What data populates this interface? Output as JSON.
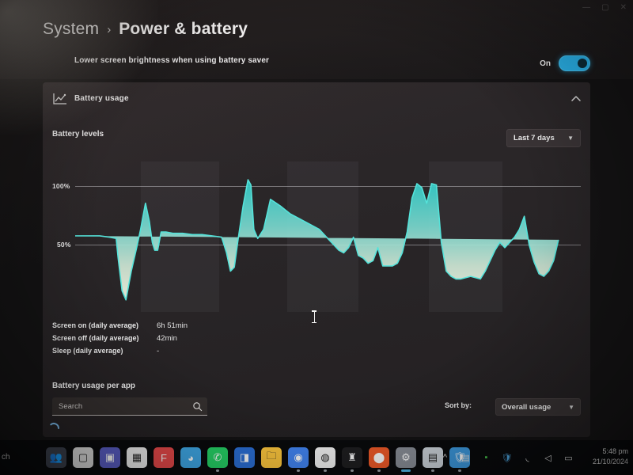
{
  "window": {
    "breadcrumb_root": "System",
    "breadcrumb_separator": "›",
    "page_title": "Power & battery",
    "controls": [
      "minimize-icon",
      "maximize-icon",
      "close-icon"
    ]
  },
  "brightness_setting": {
    "label": "Lower screen brightness when using battery saver",
    "toggle_state_label": "On",
    "toggle_on": true,
    "accent_color": "#2ab6ef"
  },
  "battery_usage_card": {
    "icon": "line-chart-icon",
    "title": "Battery usage",
    "collapse_icon": "chevron-up-icon",
    "section_title": "Battery levels",
    "range_dropdown": {
      "value": "Last 7 days",
      "chevron": "chevron-down-icon"
    },
    "stats": [
      {
        "label": "Screen on (daily average)",
        "value": "6h 51min"
      },
      {
        "label": "Screen off (daily average)",
        "value": "42min"
      },
      {
        "label": "Sleep (daily average)",
        "value": "-"
      }
    ],
    "per_app": {
      "title": "Battery usage per app",
      "search_placeholder": "Search",
      "search_value": "",
      "search_icon": "search-icon",
      "sort_by_label": "Sort by:",
      "sort_dropdown": {
        "value": "Overall usage",
        "chevron": "chevron-down-icon"
      },
      "loading": true
    }
  },
  "chart_data": {
    "type": "area",
    "title": "Battery levels",
    "xlabel": "",
    "ylabel": "",
    "ylim": [
      0,
      120
    ],
    "yticks": [
      50,
      100
    ],
    "ytick_labels": [
      "50%",
      "100%"
    ],
    "grid": true,
    "legend": false,
    "line_color": "#4fe0d8",
    "fill_gradient": [
      "#35c9c4",
      "#bfe6d0",
      "#efeede"
    ],
    "shaded_night_bands": [
      {
        "x_start": 13.5,
        "x_end": 29.5
      },
      {
        "x_start": 43.5,
        "x_end": 58.0
      },
      {
        "x_start": 72.5,
        "x_end": 87.5
      }
    ],
    "series": [
      {
        "name": "Battery level (%)",
        "x": [
          0,
          1.5,
          3,
          5,
          7,
          8.4,
          8.8,
          9.6,
          10.4,
          11.5,
          12.6,
          13.4,
          14.4,
          15.2,
          15.8,
          16.3,
          16.9,
          17.6,
          18.6,
          20,
          22,
          24,
          26,
          28,
          30,
          31,
          31.8,
          32.6,
          33.4,
          34.4,
          35.4,
          36,
          36.6,
          37.4,
          38.6,
          40,
          42,
          44,
          46,
          48,
          50,
          51,
          52,
          53,
          54,
          55,
          56,
          57,
          58,
          59,
          60,
          61,
          62,
          63,
          64,
          65,
          66,
          67,
          68,
          69,
          70,
          71,
          72,
          73,
          74,
          75,
          76,
          77,
          78,
          79,
          80,
          81,
          82,
          83,
          84,
          85,
          86,
          87,
          88,
          89,
          90,
          91,
          92,
          93,
          94,
          95,
          96,
          97,
          98,
          99,
          100
        ],
        "y": [
          57,
          57,
          57,
          57,
          56,
          55,
          40,
          15,
          8,
          30,
          48,
          62,
          82,
          68,
          52,
          46,
          46,
          60,
          60,
          59,
          59,
          58,
          58,
          57,
          56,
          44,
          30,
          33,
          55,
          80,
          100,
          96,
          62,
          55,
          62,
          85,
          80,
          74,
          70,
          66,
          62,
          58,
          54,
          50,
          46,
          44,
          48,
          56,
          42,
          40,
          36,
          38,
          48,
          34,
          34,
          34,
          36,
          44,
          60,
          86,
          97,
          94,
          82,
          97,
          96,
          52,
          30,
          26,
          24,
          24,
          25,
          26,
          25,
          24,
          30,
          38,
          46,
          52,
          48,
          52,
          56,
          62,
          72,
          50,
          37,
          28,
          26,
          30,
          38,
          54
        ]
      }
    ]
  },
  "taskbar": {
    "search_text": "ch",
    "apps": [
      {
        "name": "copilot-people-icon",
        "glyph": "👥",
        "color": "#3a3f4b",
        "running": false
      },
      {
        "name": "task-view-icon",
        "glyph": "▢",
        "color": "#dcdcdc",
        "running": false
      },
      {
        "name": "teams-icon",
        "glyph": "▣",
        "color": "#5b5fc7",
        "running": false
      },
      {
        "name": "microsoft-store-icon",
        "glyph": "▦",
        "color": "#f2f2f2",
        "running": false
      },
      {
        "name": "figma-icon",
        "glyph": "F",
        "color": "#e8494a",
        "running": false
      },
      {
        "name": "microsoft-edge-icon",
        "glyph": "◕",
        "color": "#3fa9e8",
        "running": false
      },
      {
        "name": "whatsapp-icon",
        "glyph": "✆",
        "color": "#25d366",
        "running": true
      },
      {
        "name": "office-icon",
        "glyph": "◨",
        "color": "#2b6fd6",
        "running": false
      },
      {
        "name": "file-explorer-icon",
        "glyph": "🗀",
        "color": "#ffc83d",
        "running": false
      },
      {
        "name": "google-chrome-icon",
        "glyph": "◉",
        "color": "#4285f4",
        "running": true
      },
      {
        "name": "canva-icon",
        "glyph": "◍",
        "color": "#f4f4f4",
        "running": true
      },
      {
        "name": "dark-app-icon",
        "glyph": "♜",
        "color": "#1e1e20",
        "running": true
      },
      {
        "name": "orange-app-icon",
        "glyph": "⬤",
        "color": "#f05a28",
        "running": true
      },
      {
        "name": "settings-icon",
        "glyph": "⚙",
        "color": "#8a8f98",
        "running": true
      },
      {
        "name": "task-manager-icon",
        "glyph": "▤",
        "color": "#cfd6dd",
        "running": true
      },
      {
        "name": "windows-security-icon",
        "glyph": "🛡",
        "color": "#3d9ae0",
        "running": true
      }
    ],
    "tray": [
      {
        "name": "show-hidden-icons-chevron",
        "glyph": "^"
      },
      {
        "name": "onenote-tray-icon",
        "glyph": "▤"
      },
      {
        "name": "green-tray-icon",
        "glyph": "▪"
      },
      {
        "name": "security-tray-icon",
        "glyph": "🛡"
      },
      {
        "name": "wifi-icon",
        "glyph": "◟"
      },
      {
        "name": "volume-icon",
        "glyph": "◁"
      },
      {
        "name": "battery-icon",
        "glyph": "▭"
      }
    ],
    "clock_time": "5:48 pm",
    "clock_date": "21/10/2024"
  }
}
